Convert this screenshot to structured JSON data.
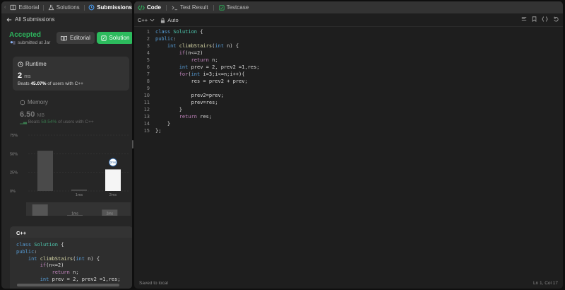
{
  "left_tabs": [
    {
      "label": "Editorial",
      "icon": "book-icon"
    },
    {
      "label": "Solutions",
      "icon": "flask-icon"
    },
    {
      "label": "Submissions",
      "icon": "history-icon",
      "active": true
    }
  ],
  "back_label": "All Submissions",
  "status": "Accepted",
  "submitted_text": "submitted at Jar",
  "buttons": {
    "editorial": "Editorial",
    "solution": "Solution"
  },
  "runtime": {
    "label": "Runtime",
    "value": "2",
    "unit": "ms",
    "beats_prefix": "Beats",
    "beats_pct": "45.07%",
    "beats_suffix": "of users with C++"
  },
  "memory": {
    "label": "Memory",
    "value": "6.50",
    "unit": "MB",
    "beats_prefix": "Beats",
    "beats_pct": "59.54%",
    "beats_suffix": "of users with C++"
  },
  "chart_data": {
    "type": "bar",
    "y_ticks": [
      "75%",
      "50%",
      "25%",
      "0%"
    ],
    "ylim": [
      0,
      75
    ],
    "categories": [
      "",
      "1ms",
      "2ms"
    ],
    "values": [
      54,
      2,
      29
    ],
    "highlight_index": 2,
    "marker_label": "2ms",
    "overview_categories": [
      "",
      "1ms",
      "2ms"
    ],
    "overview_values": [
      100,
      4,
      54
    ]
  },
  "bottom_code": {
    "lang": "C++",
    "lines": [
      "class Solution {",
      "public:",
      "    int climbStairs(int n) {",
      "        if(n<=2)",
      "            return n;",
      "        int prev = 2, prev2 =1,res;"
    ]
  },
  "right_tabs": [
    {
      "label": "Code",
      "icon": "code-icon",
      "active": true
    },
    {
      "label": "Test Result",
      "icon": "terminal-icon"
    },
    {
      "label": "Testcase",
      "icon": "checkbox-icon"
    }
  ],
  "toolbar": {
    "language": "C++",
    "mode": "Auto"
  },
  "editor_lines": [
    "class Solution {",
    "public:",
    "    int climbStairs(int n) {",
    "        if(n<=2)",
    "            return n;",
    "        int prev = 2, prev2 =1,res;",
    "        for(int i=3;i<=n;i++){",
    "            res = prev2 + prev;",
    "",
    "            prev2=prev;",
    "            prev=res;",
    "        }",
    "        return res;",
    "    }",
    "};"
  ],
  "status_bar": {
    "left": "Saved to local",
    "right": "Ln 1, Col 17"
  }
}
